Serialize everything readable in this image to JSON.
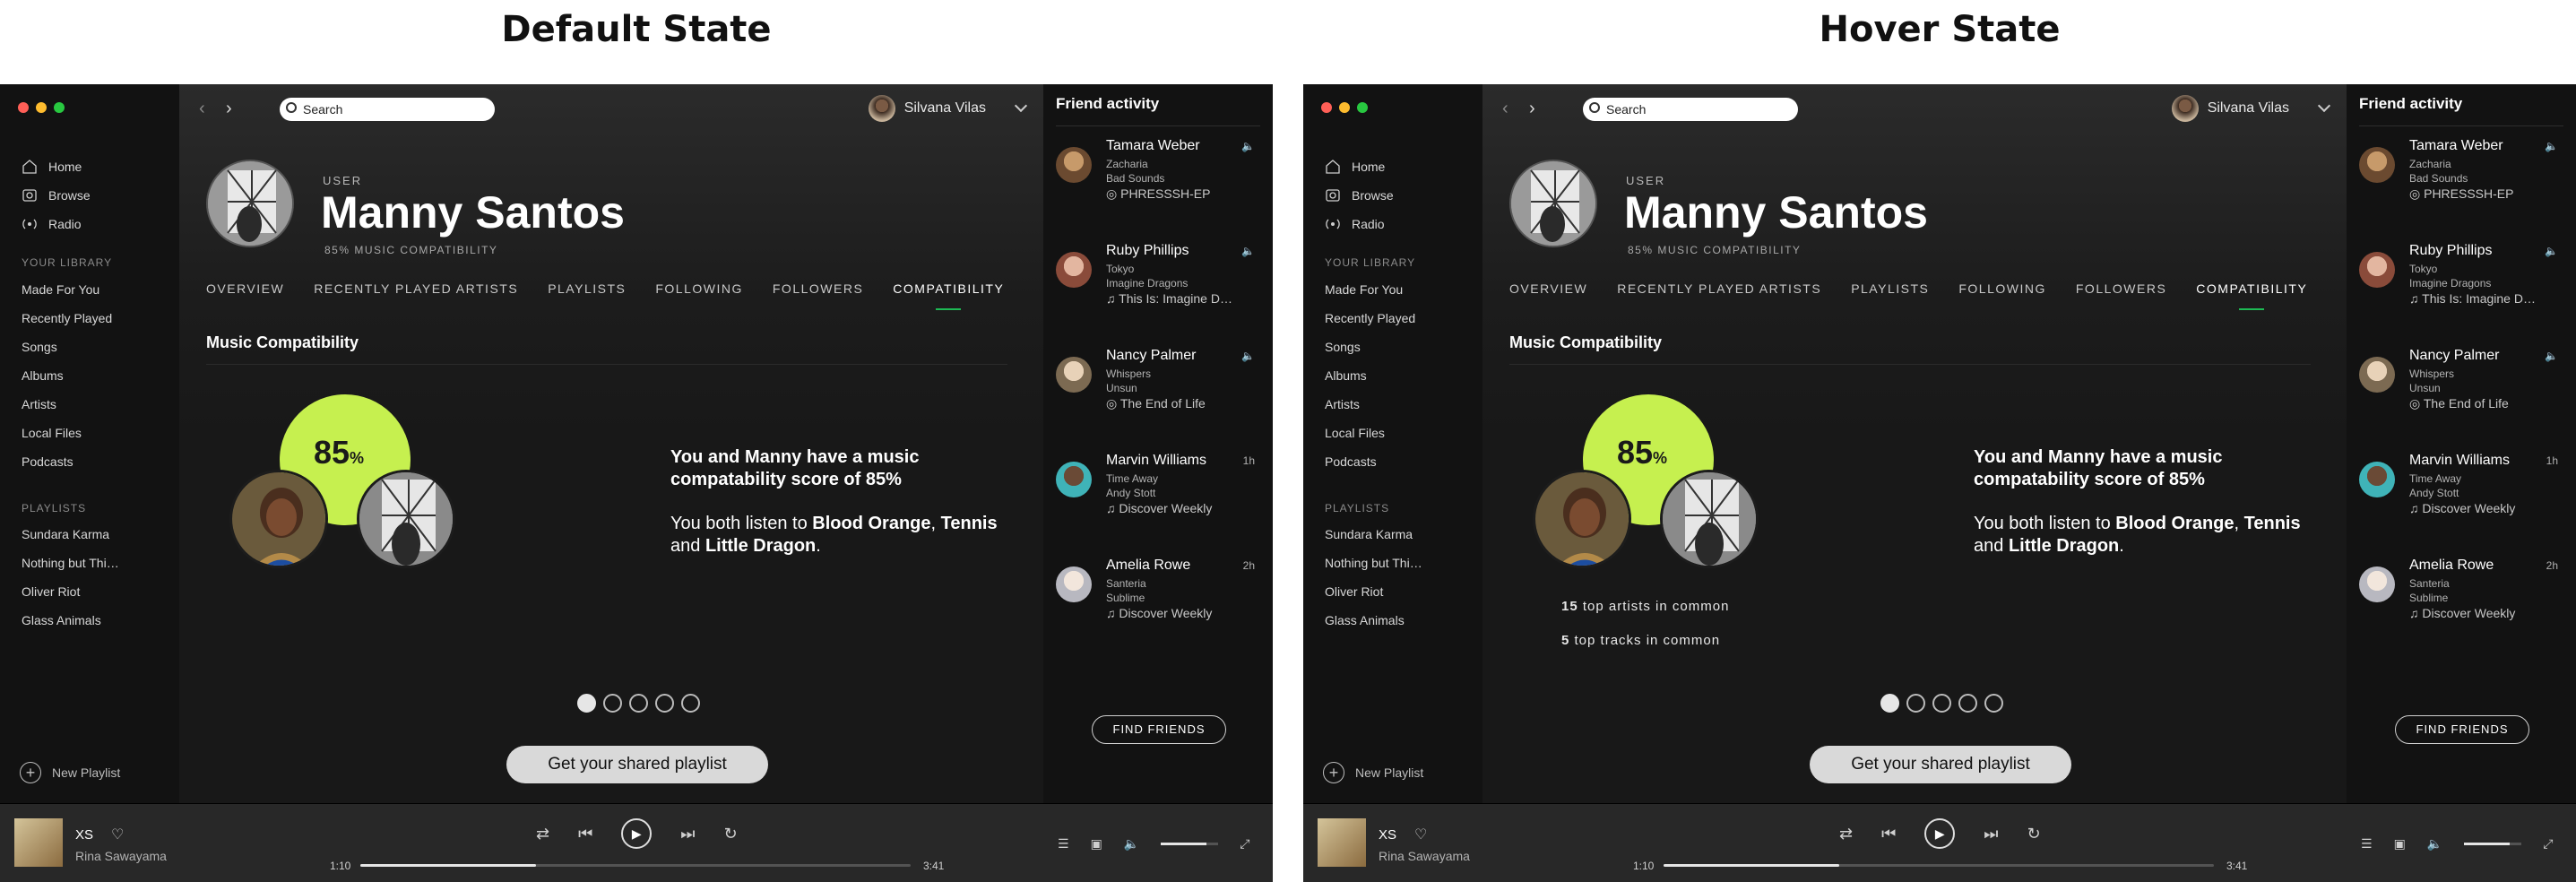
{
  "titles": {
    "default": "Default State",
    "hover": "Hover State"
  },
  "search": {
    "placeholder": "Search"
  },
  "user_chip": {
    "name": "Silvana Vilas"
  },
  "nav": [
    {
      "label": "Home",
      "icon": "home-icon"
    },
    {
      "label": "Browse",
      "icon": "browse-icon"
    },
    {
      "label": "Radio",
      "icon": "radio-icon"
    }
  ],
  "library": {
    "heading": "YOUR LIBRARY",
    "items": [
      "Made For You",
      "Recently Played",
      "Songs",
      "Albums",
      "Artists",
      "Local Files",
      "Podcasts"
    ]
  },
  "playlists": {
    "heading": "PLAYLISTS",
    "items": [
      "Sundara Karma",
      "Nothing but Thi…",
      "Oliver Riot",
      "Glass Animals"
    ]
  },
  "new_playlist": "New Playlist",
  "profile": {
    "kicker": "USER",
    "name": "Manny Santos",
    "subtitle": "85% MUSIC COMPATIBILITY"
  },
  "tabs": [
    "OVERVIEW",
    "RECENTLY PLAYED ARTISTS",
    "PLAYLISTS",
    "FOLLOWING",
    "FOLLOWERS",
    "COMPATIBILITY"
  ],
  "section_heading": "Music Compatibility",
  "compat": {
    "percent": "85",
    "percent_sign": "%",
    "headline": "You and Manny have a music compatability score of 85%",
    "listen_prefix": "You both listen to ",
    "artist1": "Blood Orange",
    "sep1": ", ",
    "artist2": "Tennis",
    "sep2": " and ",
    "artist3": "Little Dragon",
    "end": ".",
    "hover_artists_count": "15",
    "hover_artists_text": " top artists in common",
    "hover_tracks_count": "5",
    "hover_tracks_text": " top tracks in common"
  },
  "shared_button": "Get your shared playlist",
  "friends": {
    "heading": "Friend activity",
    "items": [
      {
        "name": "Tamara Weber",
        "song": "Zacharia",
        "artist": "Bad Sounds",
        "context": "PHRESSSH-EP",
        "time": "",
        "ctx_icon": "album-icon"
      },
      {
        "name": "Ruby Phillips",
        "song": "Tokyo",
        "artist": "Imagine Dragons",
        "context": "This Is: Imagine D…",
        "time": "",
        "ctx_icon": "note-icon"
      },
      {
        "name": "Nancy Palmer",
        "song": "Whispers",
        "artist": "Unsun",
        "context": "The End of Life",
        "time": "",
        "ctx_icon": "album-icon"
      },
      {
        "name": "Marvin Williams",
        "song": "Time Away",
        "artist": "Andy Stott",
        "context": "Discover Weekly",
        "time": "1h",
        "ctx_icon": "note-icon"
      },
      {
        "name": "Amelia Rowe",
        "song": "Santeria",
        "artist": "Sublime",
        "context": "Discover Weekly",
        "time": "2h",
        "ctx_icon": "note-icon"
      }
    ],
    "find_button": "FIND FRIENDS"
  },
  "player": {
    "track": "XS",
    "artist": "Rina Sawayama",
    "time_current": "1:10",
    "time_total": "3:41",
    "progress": 0.32,
    "volume": 0.8
  },
  "colors": {
    "accent_green": "#1db954",
    "bubble": "#c6f04f",
    "bg": "#181818"
  }
}
